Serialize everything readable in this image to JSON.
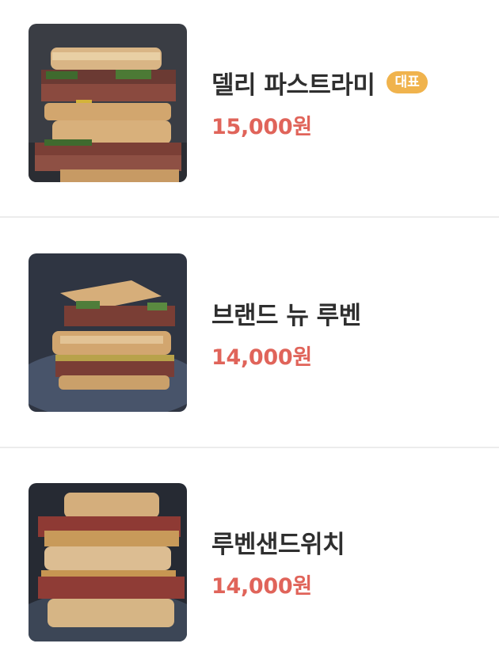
{
  "menu": {
    "items": [
      {
        "name": "델리 파스트라미",
        "badge": "대표",
        "price": "15,000원",
        "image": "sandwich-photo"
      },
      {
        "name": "브랜드 뉴 루벤",
        "price": "14,000원",
        "image": "sandwich-photo"
      },
      {
        "name": "루벤샌드위치",
        "price": "14,000원",
        "image": "sandwich-photo"
      }
    ]
  },
  "colors": {
    "price": "#e0645a",
    "badge": "#f0b34d",
    "divider": "#ececec",
    "name": "#2f2f2f"
  }
}
